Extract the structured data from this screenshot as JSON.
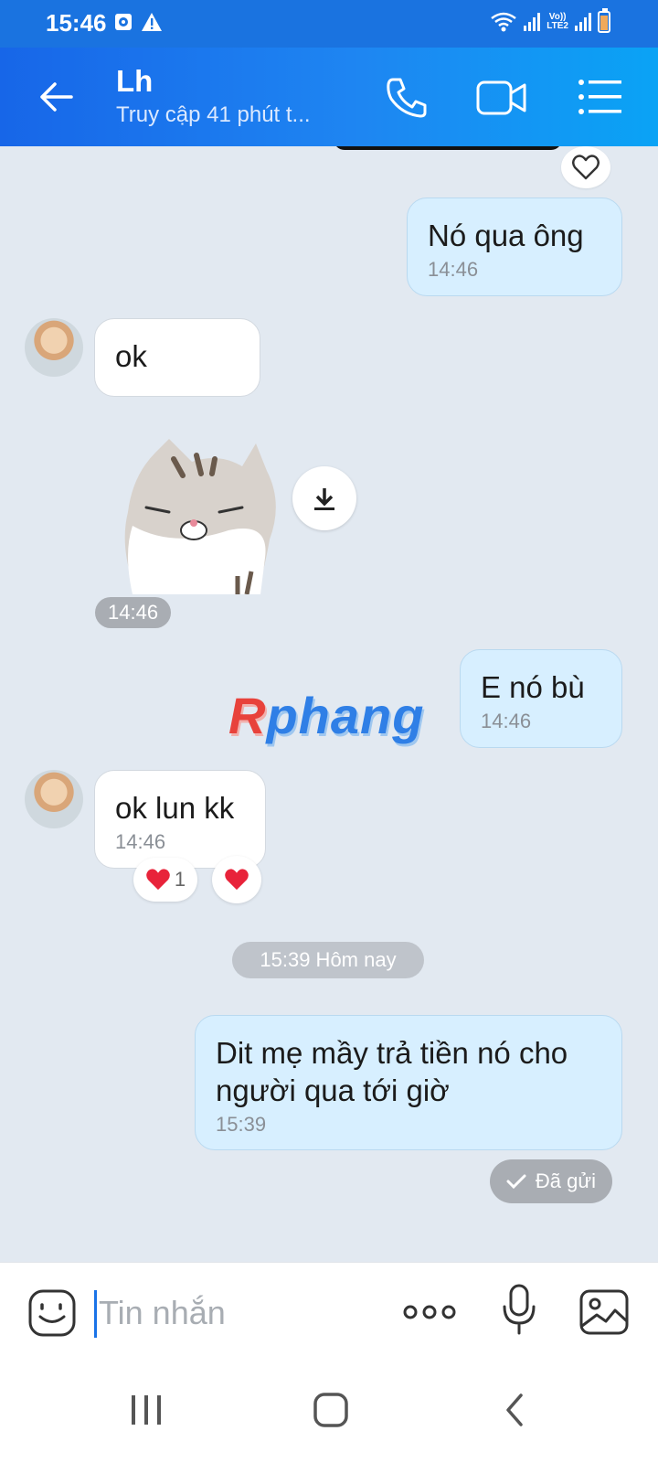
{
  "status_bar": {
    "time": "15:46",
    "carrier_label_1": "Vo))",
    "carrier_label_2": "LTE2"
  },
  "header": {
    "title": "Lh",
    "subtitle": "Truy cập 41 phút t...",
    "icons": [
      "back-arrow-icon",
      "phone-icon",
      "video-call-icon",
      "menu-list-icon"
    ]
  },
  "messages": {
    "m1": {
      "text": "Nó qua ông",
      "time": "14:46",
      "direction": "outgoing"
    },
    "m2": {
      "text": "ok",
      "direction": "incoming"
    },
    "m3": {
      "time": "14:46",
      "type": "sticker"
    },
    "m4": {
      "text": "E nó bù",
      "time": "14:46",
      "direction": "outgoing"
    },
    "m5": {
      "text": "ok lun kk",
      "time": "14:46",
      "direction": "incoming",
      "reaction_count": "1"
    },
    "m6": {
      "text": "Dit mẹ mầy trả tiền nó cho người qua tới giờ",
      "time": "15:39",
      "direction": "outgoing"
    }
  },
  "date_separator": "15:39 Hôm nay",
  "delivery_status": "Đã gửi",
  "watermark": {
    "first": "R",
    "rest": "phang"
  },
  "input": {
    "placeholder": "Tin nhắn",
    "icons": [
      "emoji-icon",
      "more-dots-icon",
      "microphone-icon",
      "image-icon"
    ]
  },
  "colors": {
    "header_start": "#1766e8",
    "header_end": "#0aa3f5",
    "outgoing_bubble": "#d7efff",
    "incoming_bubble": "#ffffff",
    "chat_background": "#e2e9f1",
    "reaction_heart": "#e8233a"
  },
  "nav": [
    "recent-apps-icon",
    "home-icon",
    "nav-back-icon"
  ]
}
